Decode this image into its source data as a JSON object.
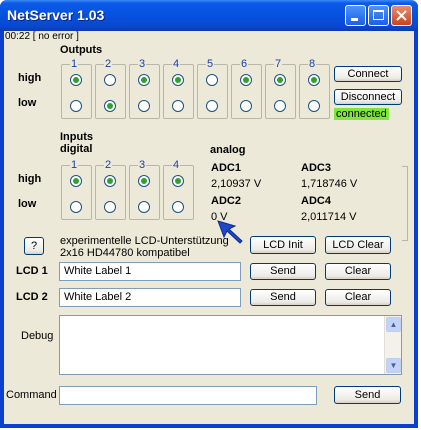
{
  "window": {
    "title": "NetServer 1.03"
  },
  "status": {
    "text": "00:22 [ no error ]"
  },
  "outputs": {
    "label": "Outputs",
    "row_high": "high",
    "row_low": "low",
    "channels": [
      "1",
      "2",
      "3",
      "4",
      "5",
      "6",
      "7",
      "8"
    ],
    "high": [
      true,
      false,
      true,
      true,
      false,
      true,
      true,
      true
    ],
    "low": [
      false,
      true,
      false,
      false,
      false,
      false,
      false,
      false
    ]
  },
  "connection": {
    "connect_label": "Connect",
    "disconnect_label": "Disconnect",
    "state": "connected",
    "state_color": "#7ee83a"
  },
  "inputs": {
    "label": "Inputs",
    "sublabel": "digital",
    "row_high": "high",
    "row_low": "low",
    "channels": [
      "1",
      "2",
      "3",
      "4"
    ],
    "high": [
      true,
      true,
      true,
      true
    ],
    "low": [
      false,
      false,
      false,
      false
    ]
  },
  "analog": {
    "label": "analog",
    "adc1": {
      "name": "ADC1",
      "value": "2,10937 V"
    },
    "adc2": {
      "name": "ADC2",
      "value": "0 V"
    },
    "adc3": {
      "name": "ADC3",
      "value": "1,718746 V"
    },
    "adc4": {
      "name": "ADC4",
      "value": "2,011714 V"
    }
  },
  "lcd": {
    "help_label": "?",
    "info_line1": "experimentelle LCD-Unterstützung",
    "info_line2": "2x16 HD44780 kompatibel",
    "init_label": "LCD Init",
    "clear_all_label": "LCD Clear",
    "lcd1_label": "LCD 1",
    "lcd1_value": "White Label 1",
    "lcd2_label": "LCD 2",
    "lcd2_value": "White Label 2",
    "send_label": "Send",
    "clear_label": "Clear"
  },
  "debug": {
    "label": "Debug",
    "value": ""
  },
  "command": {
    "label": "Command",
    "value": "",
    "send_label": "Send"
  }
}
